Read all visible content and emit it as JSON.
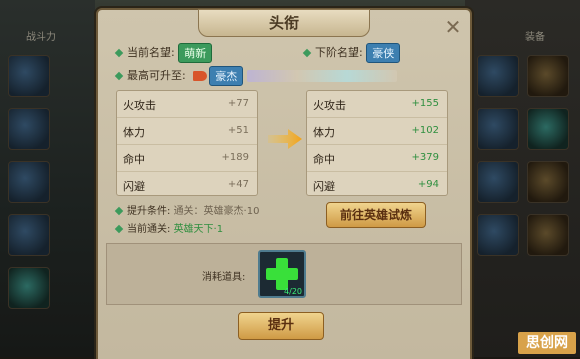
{
  "dialog": {
    "title": "头衔",
    "close_glyph": "✕"
  },
  "info": {
    "current_label": "当前名望:",
    "current_badge": "萌新",
    "next_label": "下阶名望:",
    "next_badge": "豪侠",
    "max_label": "最高可升至:",
    "max_badge": "豪杰"
  },
  "stats_current": [
    {
      "name": "火攻击",
      "value": "+77"
    },
    {
      "name": "体力",
      "value": "+51"
    },
    {
      "name": "命中",
      "value": "+189"
    },
    {
      "name": "闪避",
      "value": "+47"
    }
  ],
  "stats_next": [
    {
      "name": "火攻击",
      "value": "+155"
    },
    {
      "name": "体力",
      "value": "+102"
    },
    {
      "name": "命中",
      "value": "+379"
    },
    {
      "name": "闪避",
      "value": "+94"
    }
  ],
  "conditions": {
    "upgrade_label": "提升条件:",
    "upgrade_value": "通关：英雄豪杰·10",
    "current_label": "当前通关:",
    "current_value": "英雄天下·1"
  },
  "buttons": {
    "goto_trial": "前往英雄试炼",
    "upgrade": "提升"
  },
  "consume": {
    "label": "消耗道具:",
    "item_count": "4/20"
  },
  "watermark": "思创网",
  "background": {
    "top_left_label": "战斗力",
    "top_right_label": "装备"
  },
  "colors": {
    "accent_green": "#3c9a5c",
    "accent_blue": "#3d7fb0",
    "gold_button": "#e0b566",
    "stat_up": "#2f8f3f"
  }
}
